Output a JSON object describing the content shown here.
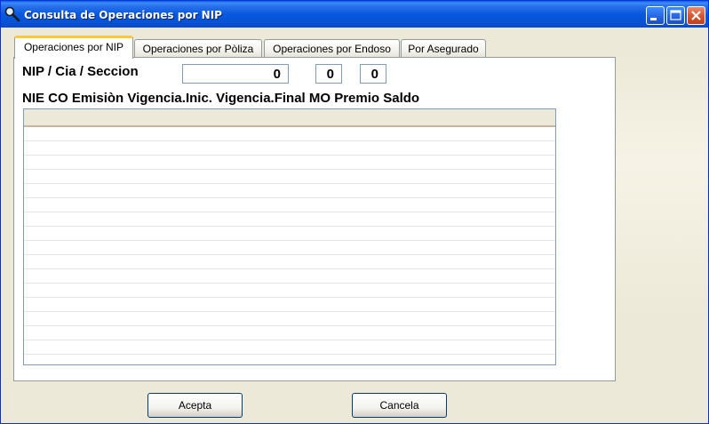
{
  "window": {
    "title": "Consulta de Operaciones por NIP"
  },
  "tabs": [
    {
      "label": "Operaciones por NIP",
      "active": true
    },
    {
      "label": "Operaciones por Pòliza",
      "active": false
    },
    {
      "label": "Operaciones por Endoso",
      "active": false
    },
    {
      "label": "Por Asegurado",
      "active": false
    }
  ],
  "form": {
    "nip_label": "NIP / Cia / Seccion",
    "nip_value": "0",
    "cia_value": "0",
    "seccion_value": "0",
    "grid_header_caption": "NIE CO Emisiòn Vigencia.Inic. Vigencia.Final MO Premio Saldo"
  },
  "buttons": {
    "accept_label": "Acepta",
    "cancel_label": "Cancela"
  },
  "icons": {
    "window_icon": "magnifier-icon",
    "minimize": "minimize-icon",
    "maximize": "maximize-icon",
    "close": "close-icon"
  },
  "colors": {
    "titlebar": "#0858DE",
    "close_button": "#D8542E",
    "active_tab_accent": "#FFC83C",
    "face": "#ECE9D8"
  }
}
